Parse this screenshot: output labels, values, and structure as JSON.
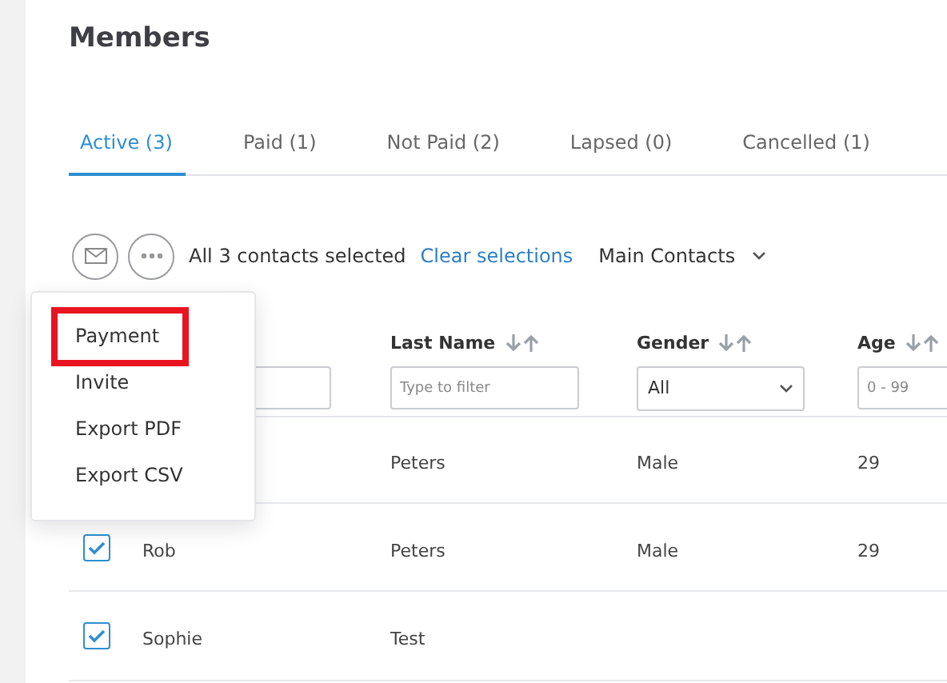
{
  "title": "Members",
  "tabs": [
    {
      "label": "Active (3)",
      "selected": true
    },
    {
      "label": "Paid (1)",
      "selected": false
    },
    {
      "label": "Not Paid (2)",
      "selected": false
    },
    {
      "label": "Lapsed (0)",
      "selected": false
    },
    {
      "label": "Cancelled (1)",
      "selected": false
    }
  ],
  "toolbar": {
    "selection_text": "All 3 contacts selected",
    "clear_link": "Clear selections",
    "contact_filter": "Main Contacts"
  },
  "menu": [
    {
      "label": "Payment",
      "highlighted": true
    },
    {
      "label": "Invite",
      "highlighted": false
    },
    {
      "label": "Export PDF",
      "highlighted": false
    },
    {
      "label": "Export CSV",
      "highlighted": false
    }
  ],
  "table": {
    "columns": [
      {
        "label": "Last Name",
        "filter": {
          "kind": "text",
          "placeholder": "Type to filter"
        }
      },
      {
        "label": "Gender",
        "filter": {
          "kind": "select",
          "value": "All"
        }
      },
      {
        "label": "Age",
        "filter": {
          "kind": "text",
          "placeholder": "0 - 99"
        }
      }
    ],
    "rows": [
      {
        "cells": [
          "Peters",
          "Male",
          "29"
        ]
      },
      {
        "checked": true,
        "first_name": "Rob",
        "cells": [
          "Peters",
          "Male",
          "29"
        ]
      },
      {
        "checked": true,
        "first_name": "Sophie",
        "cells": [
          "Test",
          "",
          ""
        ]
      }
    ]
  }
}
